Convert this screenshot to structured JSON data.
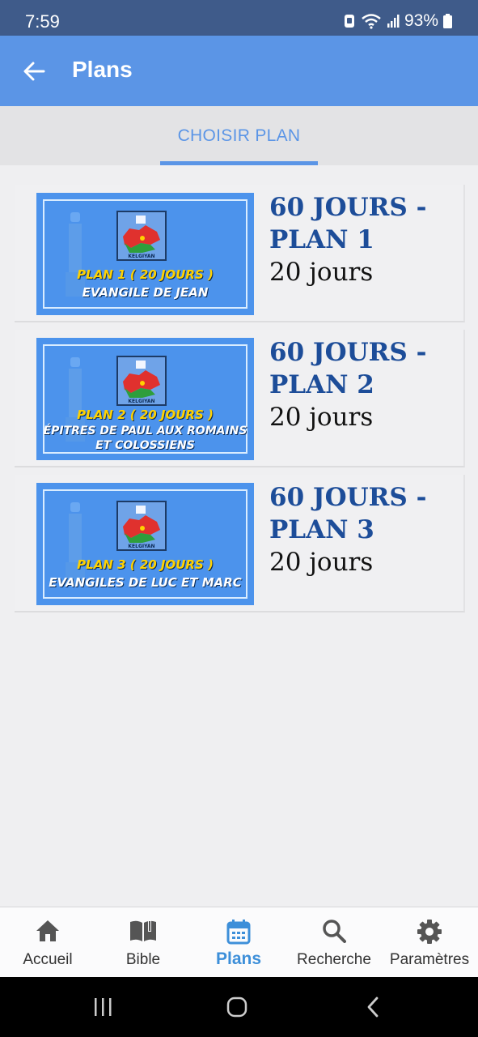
{
  "status": {
    "time": "7:59",
    "battery": "93%"
  },
  "app_bar": {
    "title": "Plans"
  },
  "tabs": [
    {
      "label": "CHOISIR PLAN"
    }
  ],
  "plans": [
    {
      "title": "60 JOURS - PLAN 1",
      "duration": "20 jours",
      "thumb_line1": "PLAN 1 ( 20 JOURS )",
      "thumb_line2": "EVANGILE DE JEAN",
      "thumb_logo_text": "KELGIYAN"
    },
    {
      "title": "60 JOURS - PLAN 2",
      "duration": "20 jours",
      "thumb_line1": "PLAN 2 ( 20 JOURS )",
      "thumb_line2": "ÉPITRES DE PAUL AUX ROMAINS ET COLOSSIENS",
      "thumb_logo_text": "KELGIYAN"
    },
    {
      "title": "60 JOURS - PLAN 3",
      "duration": "20 jours",
      "thumb_line1": "PLAN 3 ( 20 JOURS )",
      "thumb_line2": "EVANGILES DE LUC ET MARC",
      "thumb_logo_text": "KELGIYAN"
    }
  ],
  "bottom_nav": [
    {
      "label": "Accueil",
      "icon": "home-icon"
    },
    {
      "label": "Bible",
      "icon": "book-icon"
    },
    {
      "label": "Plans",
      "icon": "calendar-icon",
      "active": true
    },
    {
      "label": "Recherche",
      "icon": "search-icon"
    },
    {
      "label": "Paramètres",
      "icon": "gear-icon"
    }
  ],
  "colors": {
    "app_bar": "#5b95e6",
    "status_bar": "#3f5b8a",
    "accent": "#3d8fd9",
    "plan_title": "#1d4d99"
  }
}
